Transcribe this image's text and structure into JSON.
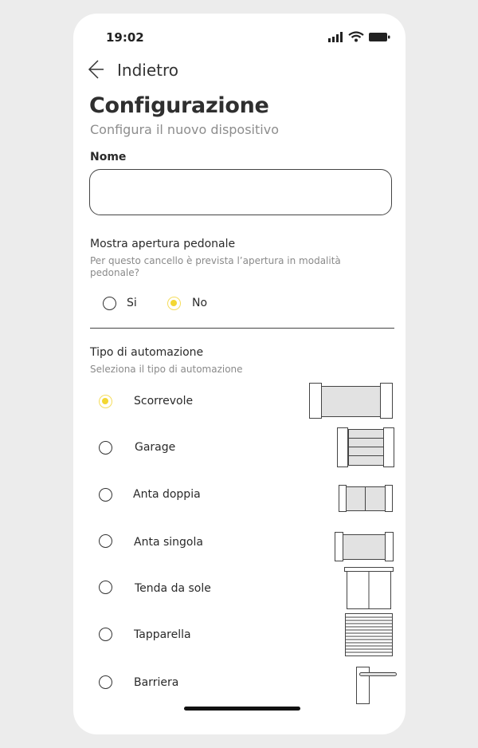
{
  "status_bar": {
    "time": "19:02",
    "signal_icon": "signal-icon",
    "wifi_icon": "wifi-icon",
    "battery_icon": "battery-icon"
  },
  "nav": {
    "back_label": "Indietro",
    "back_icon": "arrow-left-icon"
  },
  "header": {
    "title": "Configurazione",
    "subtitle": "Configura il nuovo dispositivo"
  },
  "name_field": {
    "label": "Nome",
    "value": "",
    "placeholder": ""
  },
  "pedestrian": {
    "title": "Mostra apertura pedonale",
    "description": "Per questo cancello è prevista l’apertura in modalità pedonale?",
    "options": [
      {
        "label": "Si",
        "selected": false
      },
      {
        "label": "No",
        "selected": true
      }
    ]
  },
  "automation": {
    "title": "Tipo di automazione",
    "description": "Seleziona il tipo di automazione",
    "options": [
      {
        "label": "Scorrevole",
        "selected": true,
        "icon": "sliding-gate-icon"
      },
      {
        "label": "Garage",
        "selected": false,
        "icon": "garage-door-icon"
      },
      {
        "label": "Anta doppia",
        "selected": false,
        "icon": "double-leaf-gate-icon"
      },
      {
        "label": "Anta singola",
        "selected": false,
        "icon": "single-leaf-gate-icon"
      },
      {
        "label": "Tenda da sole",
        "selected": false,
        "icon": "awning-icon"
      },
      {
        "label": "Tapparella",
        "selected": false,
        "icon": "roller-shutter-icon"
      },
      {
        "label": "Barriera",
        "selected": false,
        "icon": "barrier-icon"
      }
    ]
  },
  "colors": {
    "accent": "#f3d732",
    "text": "#2b2b2b",
    "muted": "#8a8a8a",
    "background": "#ececec"
  }
}
